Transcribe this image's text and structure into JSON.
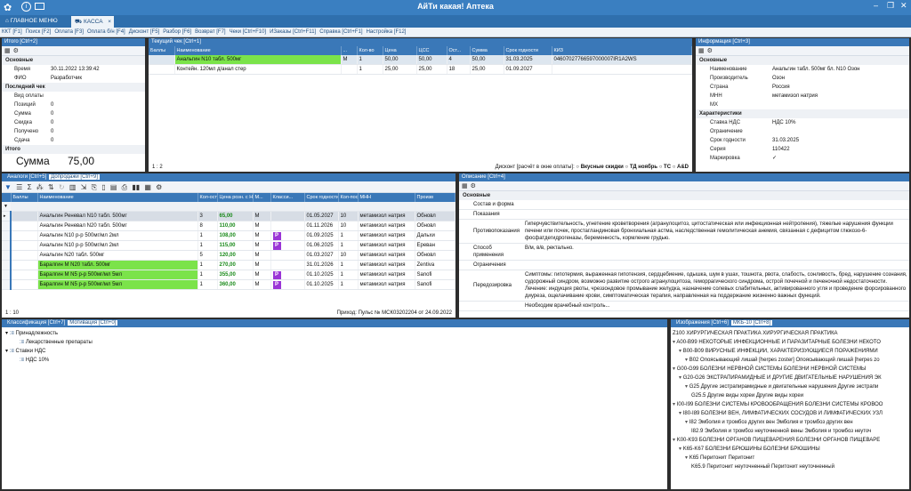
{
  "window": {
    "title": "АйТи какая! Аптека"
  },
  "tabs": [
    {
      "label": "ГЛАВНОЕ МЕНЮ"
    },
    {
      "label": "КАССА"
    }
  ],
  "menu": [
    "ККТ [F1]",
    "Поиск [F2]",
    "Оплата [F3]",
    "Оплата б/н [F4]",
    "Дисконт [F5]",
    "Разбор [F6]",
    "Возврат [F7]",
    "Чеки [Ctrl+F10]",
    "ИЗаказы [Ctrl+F11]",
    "Справка [Ctrl+F1]",
    "Настройка [F12]"
  ],
  "itogo": {
    "title": "Итого [Ctrl+2]",
    "sec_main": "Основные",
    "time_label": "Время",
    "time_value": "30.11.2022 13:39:42",
    "fio_label": "ФИО",
    "fio_value": "Разработчик",
    "sec_last": "Последний чек",
    "pay_label": "Вид оплаты",
    "pay_value": "",
    "pos_label": "Позиций",
    "pos_value": "0",
    "sum_label": "Сумма",
    "sum_value": "0",
    "disc_label": "Скидка",
    "disc_value": "0",
    "recv_label": "Получено",
    "recv_value": "0",
    "change_label": "Сдача",
    "change_value": "0",
    "sec_total": "Итого",
    "big_label": "Сумма",
    "big_value": "75,00"
  },
  "current": {
    "title": "Текущий чек [Ctrl+1]",
    "headers": [
      "Баллы",
      "Наименование",
      "...",
      "Кол-во",
      "Цена",
      "ЦСС",
      "Ост...",
      "Сумма",
      "Срок годности",
      "КИЗ"
    ],
    "rows": [
      [
        "",
        "Анальгин N10 табл. 500мг",
        "М",
        "1",
        "50,00",
        "50,00",
        "4",
        "50,00",
        "31.03.2025",
        "04607027766597000007IR1A2WS"
      ],
      [
        "",
        "Контейн. 120мл д/анал стер",
        "",
        "1",
        "25,00",
        "25,00",
        "18",
        "25,00",
        "01.09.2027",
        ""
      ]
    ],
    "pager": "1 : 2",
    "discount": "Дисконт [расчёт в окне оплаты]:",
    "opts": [
      "Вкусные скидки",
      "ТД ноябрь",
      "ТС",
      "A&D"
    ]
  },
  "info": {
    "title": "Информация [Ctrl+3]",
    "sec_main": "Основные",
    "rows": [
      {
        "k": "Наименование",
        "v": "Анальгин табл. 500мг бл. N10 Озон"
      },
      {
        "k": "Производитель",
        "v": "Озон"
      },
      {
        "k": "Страна",
        "v": "Россия"
      },
      {
        "k": "МНН",
        "v": "метамизол натрия"
      },
      {
        "k": "МХ",
        "v": ""
      }
    ],
    "sec_char": "Характеристики",
    "rows2": [
      {
        "k": "Ставка НДС",
        "v": "НДС 10%"
      },
      {
        "k": "Ограничение",
        "v": ""
      },
      {
        "k": "Срок годности",
        "v": "31.03.2025"
      },
      {
        "k": "Серия",
        "v": "110422"
      },
      {
        "k": "Маркировка",
        "v": "✓"
      }
    ]
  },
  "analogs": {
    "tabs": [
      "Аналоги [Ctrl+5]",
      "Допродажи [Ctrl+9]"
    ],
    "headers": [
      "Баллы",
      "Наименование",
      "Кол-оста",
      "Цена розн. с НДС",
      "М...",
      "Класси...",
      "Срок годности",
      "Кол-пост",
      "МНН",
      "Произв"
    ],
    "rows": [
      [
        "",
        "",
        "",
        "",
        "",
        "",
        "",
        "",
        "",
        ""
      ],
      [
        "",
        "Анальгин Реневал N10 табл. 500мг",
        "3",
        "65,00",
        "М",
        "",
        "01.05.2027",
        "10",
        "метамизол натрия",
        "Обновл"
      ],
      [
        "",
        "Анальгин Реневал N20 табл. 500мг",
        "8",
        "110,00",
        "М",
        "",
        "01.11.2026",
        "10",
        "метамизол натрия",
        "Обновл"
      ],
      [
        "",
        "Анальгин N10 р-р 500мг/мл 2мл",
        "1",
        "108,00",
        "М",
        "P",
        "01.09.2025",
        "1",
        "метамизол натрия",
        "Дальхи"
      ],
      [
        "",
        "Анальгин N10 р-р 500мг/мл 2мл",
        "1",
        "115,00",
        "М",
        "P",
        "01.06.2025",
        "1",
        "метамизол натрия",
        "Ереван"
      ],
      [
        "",
        "Анальгин N20 табл. 500мг",
        "5",
        "120,00",
        "М",
        "",
        "01.03.2027",
        "10",
        "метамизол натрия",
        "Обновл"
      ],
      [
        "",
        "Баралгин М N20 табл. 500мг",
        "1",
        "270,00",
        "М",
        "",
        "31.01.2026",
        "1",
        "метамизол натрия",
        "Zentiva"
      ],
      [
        "",
        "Баралгин М N5 р-р 500мг/мл 5мл",
        "1",
        "355,00",
        "М",
        "P",
        "01.10.2025",
        "1",
        "метамизол натрия",
        "Sanofi"
      ],
      [
        "",
        "Баралгин М N5 р-р 500мг/мл 5мл",
        "1",
        "360,00",
        "М",
        "P",
        "01.10.2025",
        "1",
        "метамизол натрия",
        "Sanofi"
      ]
    ],
    "pager": "1 : 10",
    "prihod": "Приход: Пульс № МСК03202204 от 24.09.2022"
  },
  "desc": {
    "title": "Описание [Ctrl+4]",
    "sec": "Основные",
    "rows": [
      {
        "k": "Состав и форма",
        "v": ""
      },
      {
        "k": "Показания",
        "v": ""
      },
      {
        "k": "Противопоказания",
        "v": "Гиперчувствительность, угнетение кроветворения (агранулоцитоз, цитостатическая или инфекционная нейтропения), тяжелые нарушения функции печени или почек, простагландиновая бронхиальная астма, наследственная гемолитическая анемия, связанная с дефицитом глюкозо-6-фосфатдегидрогеназы, беременность, кормление грудью."
      },
      {
        "k": "Способ применения",
        "v": "В/м, в/в, ректально."
      },
      {
        "k": "Ограничения",
        "v": ""
      },
      {
        "k": "Передозировка",
        "v": "Симптомы: гипотермия, выраженная гипотензия, сердцебиение, одышка, шум в ушах, тошнота, рвота, слабость, сонливость, бред, нарушение сознания, судорожный синдром, возможно развитие острого агранулоцитоза, геморрагического синдрома, острой почечной и печеночной недостаточности. Лечение: индукция рвоты, чреззондовое промывание желудка, назначение солевых слабительных, активированного угля и проведение форсированного диуреза, ощелачивание крови, симптоматическая терапия, направленная на поддержание жизненно важных функций."
      },
      {
        "k": "",
        "v": "Необходим врачебный контроль..."
      }
    ]
  },
  "classif": {
    "tabs": [
      "Классификация [Ctrl+7]",
      "Мотивация [Ctrl+0]"
    ],
    "items": [
      "Принадлежность",
      "Лекарственные препараты",
      "Ставки НДС",
      "НДС 10%"
    ]
  },
  "mkb": {
    "tabs": [
      "Изображения [Ctrl+6]",
      "МКБ-10 [Ctrl+8]"
    ],
    "items": [
      {
        "lvl": 1,
        "t": "Z100 ХИРУРГИЧЕСКАЯ ПРАКТИКА ХИРУРГИЧЕСКАЯ ПРАКТИКА"
      },
      {
        "lvl": 1,
        "t": "A00-B99 НЕКОТОРЫЕ ИНФЕКЦИОННЫЕ И ПАРАЗИТАРНЫЕ БОЛЕЗНИ НЕКОТО"
      },
      {
        "lvl": 2,
        "t": "B00-B09 ВИРУСНЫЕ ИНФЕКЦИИ, ХАРАКТЕРИЗУЮЩИЕСЯ ПОРАЖЕНИЯМИ"
      },
      {
        "lvl": 3,
        "t": "B02 Опоясывающий лишай [herpes zoster] Опоясывающий лишай [herpes zo"
      },
      {
        "lvl": 1,
        "t": "G00-G99 БОЛЕЗНИ НЕРВНОЙ СИСТЕМЫ БОЛЕЗНИ НЕРВНОЙ СИСТЕМЫ"
      },
      {
        "lvl": 2,
        "t": "G20-G26 ЭКСТРАПИРАМИДНЫЕ И ДРУГИЕ ДВИГАТЕЛЬНЫЕ НАРУШЕНИЯ ЭК"
      },
      {
        "lvl": 3,
        "t": "G25 Другие экстрапирамидные и двигательные нарушения Другие экстрапи"
      },
      {
        "lvl": 4,
        "t": "G25.5 Другие виды хореи Другие виды хореи"
      },
      {
        "lvl": 1,
        "t": "I00-I99 БОЛЕЗНИ СИСТЕМЫ КРОВООБРАЩЕНИЯ БОЛЕЗНИ СИСТЕМЫ КРОВОО"
      },
      {
        "lvl": 2,
        "t": "I80-I89 БОЛЕЗНИ ВЕН, ЛИМФАТИЧЕСКИХ СОСУДОВ И ЛИМФАТИЧЕСКИХ УЗЛ"
      },
      {
        "lvl": 3,
        "t": "I82 Эмболия и тромбоз других вен Эмболия и тромбоз других вен"
      },
      {
        "lvl": 4,
        "t": "I82.9 Эмболия и тромбоз неуточненной вены Эмболия и тромбоз неуточ"
      },
      {
        "lvl": 1,
        "t": "K00-K93 БОЛЕЗНИ ОРГАНОВ ПИЩЕВАРЕНИЯ БОЛЕЗНИ ОРГАНОВ ПИЩЕВАРЕ"
      },
      {
        "lvl": 2,
        "t": "K65-K67 БОЛЕЗНИ БРЮШИНЫ БОЛЕЗНИ БРЮШИНЫ"
      },
      {
        "lvl": 3,
        "t": "K65 Перитонит Перитонит"
      },
      {
        "lvl": 4,
        "t": "K65.9 Перитонит неуточненный Перитонит неуточненный"
      }
    ]
  }
}
